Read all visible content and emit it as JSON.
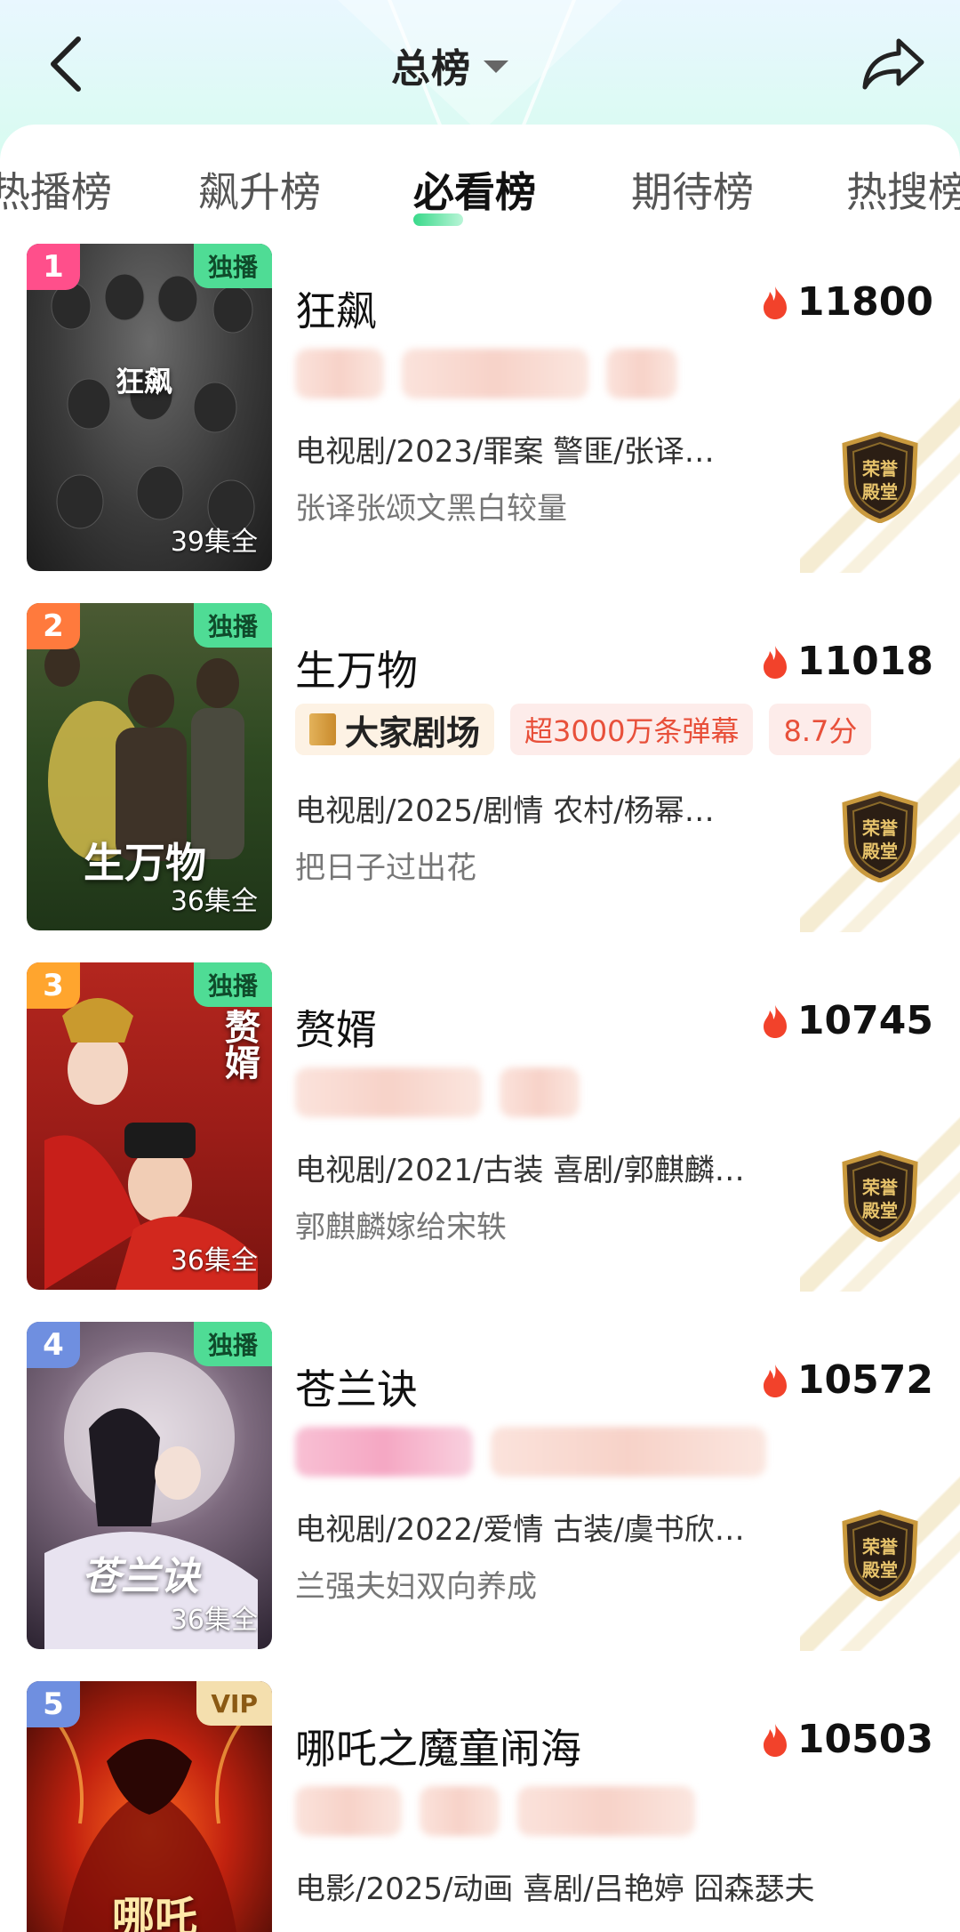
{
  "header": {
    "title": "总榜",
    "back_icon": "chevron-left-icon",
    "share_icon": "share-arrow-icon"
  },
  "tabs": [
    {
      "label": "热播榜",
      "active": false
    },
    {
      "label": "飙升榜",
      "active": false
    },
    {
      "label": "必看榜",
      "active": true
    },
    {
      "label": "期待榜",
      "active": false
    },
    {
      "label": "热搜榜",
      "active": false
    }
  ],
  "colors": {
    "accent_green": "#39d98a",
    "rank1": "#ff4f8b",
    "rank2": "#ff7a3d",
    "rank3": "#ffa52e",
    "rank4": "#6f8fe0",
    "rank5": "#6f8fe0",
    "flame": "#f2422b"
  },
  "items": [
    {
      "rank": "1",
      "badge": "独播",
      "episodes": "39集全",
      "poster_title": "狂飙",
      "name": "狂飙",
      "heat": "11800",
      "meta": "电视剧/2023/罪案 警匪/张译…",
      "sub": "张译张颂文黑白较量",
      "honor": "荣誉殿堂"
    },
    {
      "rank": "2",
      "badge": "独播",
      "episodes": "36集全",
      "poster_title": "生万物",
      "name": "生万物",
      "heat": "11018",
      "tags": {
        "theater": "大家剧场",
        "danmu": "超3000万条弹幕",
        "score": "8.7分"
      },
      "meta": "电视剧/2025/剧情 农村/杨幂…",
      "sub": "把日子过出花",
      "honor": "荣誉殿堂"
    },
    {
      "rank": "3",
      "badge": "独播",
      "episodes": "36集全",
      "poster_title": "赘婿",
      "name": "赘婿",
      "heat": "10745",
      "meta": "电视剧/2021/古装 喜剧/郭麒麟…",
      "sub": "郭麒麟嫁给宋轶",
      "honor": "荣誉殿堂"
    },
    {
      "rank": "4",
      "badge": "独播",
      "episodes": "36集全",
      "poster_title": "苍兰诀",
      "name": "苍兰诀",
      "heat": "10572",
      "meta": "电视剧/2022/爱情 古装/虞书欣…",
      "sub": "兰强夫妇双向养成",
      "honor": "荣誉殿堂"
    },
    {
      "rank": "5",
      "badge": "VIP",
      "poster_title": "哪吒",
      "name": "哪吒之魔童闹海",
      "heat": "10503",
      "meta": "电影/2025/动画 喜剧/吕艳婷 囧森瑟夫"
    }
  ]
}
